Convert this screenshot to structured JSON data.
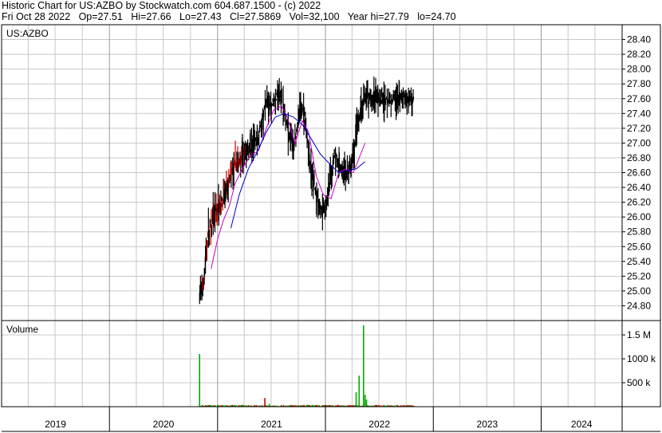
{
  "header": {
    "line1": "Historic Chart for US:AZBO by Stockwatch.com 604.687.1500 - (c) 2022",
    "line2": "Fri Oct 28 2022   Op=27.51   Hi=27.66   Lo=27.43   Cl=27.5869   Vol=32,100   Year hi=27.79   lo=24.70"
  },
  "chart_data": [
    {
      "type": "ohlc",
      "label": "US:AZBO",
      "ylim": [
        24.6,
        28.6
      ],
      "y_ticks": [
        "28.40",
        "28.20",
        "28.00",
        "27.80",
        "27.60",
        "27.40",
        "27.20",
        "27.00",
        "26.80",
        "26.60",
        "26.40",
        "26.20",
        "26.00",
        "25.80",
        "25.60",
        "25.40",
        "25.20",
        "25.00",
        "24.80"
      ],
      "y_tick_values": [
        28.4,
        28.2,
        28.0,
        27.8,
        27.6,
        27.4,
        27.2,
        27.0,
        26.8,
        26.6,
        26.4,
        26.2,
        26.0,
        25.8,
        25.6,
        25.4,
        25.2,
        25.0,
        24.8
      ],
      "x_years": [
        "2019",
        "2020",
        "2021",
        "2022",
        "2023",
        "2024"
      ],
      "data_start": "2020-11",
      "data_end": "2022-10-28",
      "price_path": [
        [
          "2020-11-01",
          24.95
        ],
        [
          "2020-11-15",
          25.15
        ],
        [
          "2020-12-01",
          25.8
        ],
        [
          "2020-12-15",
          25.95
        ],
        [
          "2021-01-01",
          26.1
        ],
        [
          "2021-01-15",
          26.2
        ],
        [
          "2021-02-01",
          26.35
        ],
        [
          "2021-02-15",
          26.55
        ],
        [
          "2021-03-01",
          26.68
        ],
        [
          "2021-03-15",
          26.78
        ],
        [
          "2021-04-01",
          26.88
        ],
        [
          "2021-04-15",
          26.92
        ],
        [
          "2021-05-01",
          26.95
        ],
        [
          "2021-05-15",
          27.05
        ],
        [
          "2021-06-01",
          27.3
        ],
        [
          "2021-06-15",
          27.55
        ],
        [
          "2021-07-01",
          27.5
        ],
        [
          "2021-07-15",
          27.6
        ],
        [
          "2021-08-01",
          27.65
        ],
        [
          "2021-08-15",
          27.4
        ],
        [
          "2021-09-01",
          27.1
        ],
        [
          "2021-09-15",
          26.9
        ],
        [
          "2021-10-01",
          27.3
        ],
        [
          "2021-10-15",
          27.55
        ],
        [
          "2021-11-01",
          27.1
        ],
        [
          "2021-11-15",
          26.6
        ],
        [
          "2021-12-01",
          26.3
        ],
        [
          "2021-12-15",
          26.05
        ],
        [
          "2022-01-01",
          26.2
        ],
        [
          "2022-01-15",
          26.4
        ],
        [
          "2022-02-01",
          26.9
        ],
        [
          "2022-02-15",
          26.7
        ],
        [
          "2022-03-01",
          26.6
        ],
        [
          "2022-03-15",
          26.55
        ],
        [
          "2022-04-01",
          26.7
        ],
        [
          "2022-04-15",
          27.1
        ],
        [
          "2022-05-01",
          27.45
        ],
        [
          "2022-05-15",
          27.6
        ]
      ],
      "ma_short": [
        [
          "2020-12-10",
          25.3
        ],
        [
          "2021-01-01",
          25.7
        ],
        [
          "2021-01-20",
          25.95
        ],
        [
          "2021-02-10",
          26.15
        ],
        [
          "2021-03-01",
          26.45
        ],
        [
          "2021-03-25",
          26.65
        ],
        [
          "2021-04-20",
          26.82
        ],
        [
          "2021-05-20",
          26.9
        ],
        [
          "2021-06-15",
          27.2
        ],
        [
          "2021-07-10",
          27.45
        ],
        [
          "2021-08-05",
          27.5
        ],
        [
          "2021-08-25",
          27.35
        ],
        [
          "2021-09-20",
          27.0
        ],
        [
          "2021-10-15",
          27.3
        ],
        [
          "2021-11-05",
          27.15
        ],
        [
          "2021-12-01",
          26.55
        ],
        [
          "2021-12-25",
          26.3
        ],
        [
          "2022-01-20",
          26.25
        ],
        [
          "2022-02-15",
          26.6
        ],
        [
          "2022-03-10",
          26.65
        ],
        [
          "2022-04-05",
          26.6
        ],
        [
          "2022-04-25",
          26.8
        ],
        [
          "2022-05-15",
          27.0
        ]
      ],
      "ma_long": [
        [
          "2021-02-15",
          25.85
        ],
        [
          "2021-03-15",
          26.3
        ],
        [
          "2021-04-15",
          26.65
        ],
        [
          "2021-05-15",
          26.88
        ],
        [
          "2021-06-15",
          27.15
        ],
        [
          "2021-07-15",
          27.35
        ],
        [
          "2021-08-15",
          27.4
        ],
        [
          "2021-09-15",
          27.35
        ],
        [
          "2021-10-15",
          27.25
        ],
        [
          "2021-11-15",
          27.05
        ],
        [
          "2021-12-15",
          26.85
        ],
        [
          "2022-01-15",
          26.72
        ],
        [
          "2022-02-15",
          26.6
        ],
        [
          "2022-03-15",
          26.63
        ],
        [
          "2022-04-15",
          26.65
        ],
        [
          "2022-05-15",
          26.75
        ]
      ]
    },
    {
      "type": "bar",
      "label": "Volume",
      "ylim": [
        0,
        1800000
      ],
      "y_ticks": [
        "1.5 M",
        "1000 k",
        "500 k"
      ],
      "y_tick_values": [
        1500000,
        1000000,
        500000
      ],
      "spikes": [
        [
          "2020-11-01",
          1100000
        ],
        [
          "2021-06-10",
          180000
        ],
        [
          "2021-06-25",
          60000
        ],
        [
          "2021-11-01",
          40000
        ],
        [
          "2022-04-15",
          300000
        ],
        [
          "2022-04-25",
          650000
        ],
        [
          "2022-05-10",
          1700000
        ],
        [
          "2022-05-15",
          250000
        ],
        [
          "2022-05-20",
          150000
        ]
      ],
      "baseline_volume": 25000
    }
  ],
  "colors": {
    "price_up": "#000000",
    "price_down": "#cc0000",
    "ma_short": "#cc00cc",
    "ma_long": "#0000cc",
    "vol_up": "#00aa00",
    "vol_down": "#cc0000",
    "grid": "#c8c8c8"
  }
}
